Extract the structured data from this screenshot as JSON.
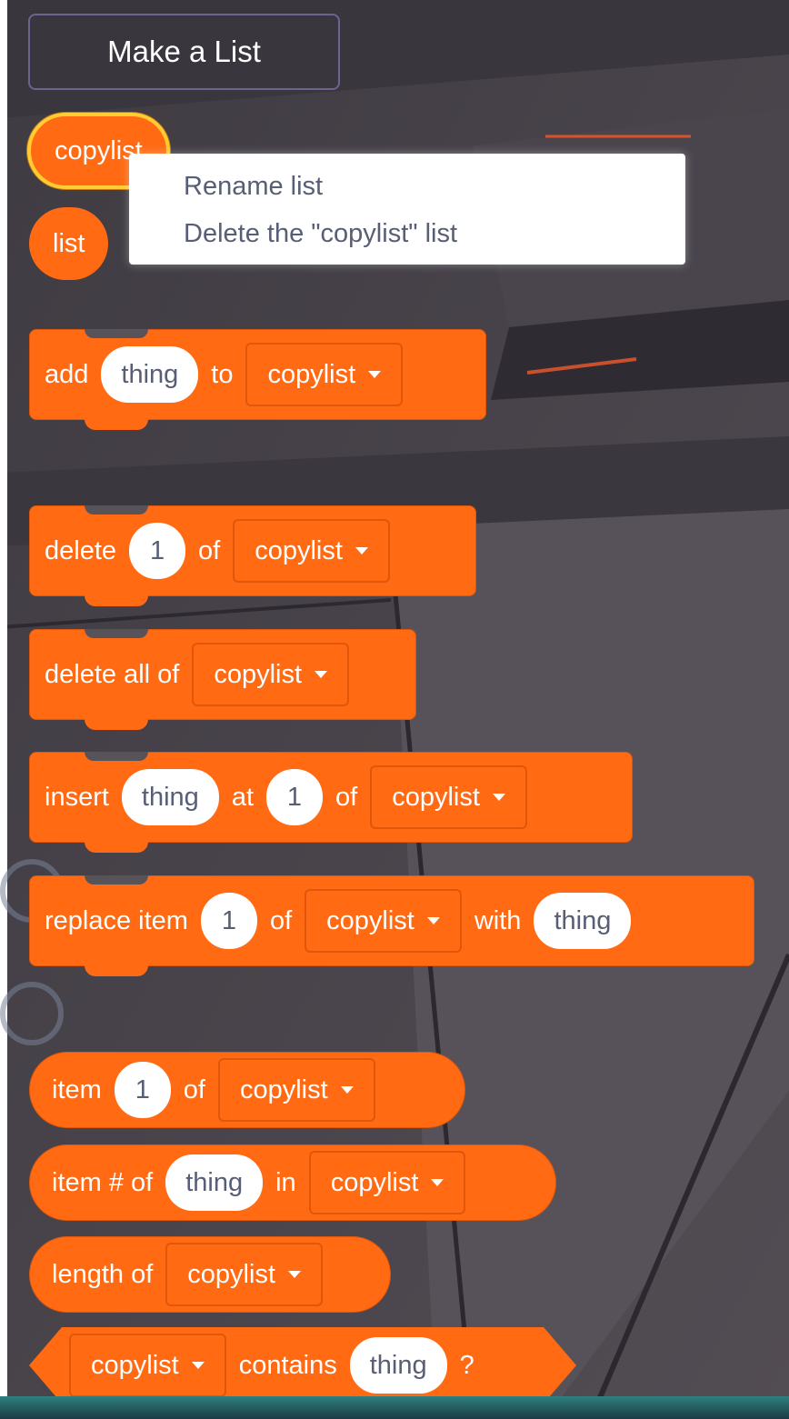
{
  "palette": {
    "make_list_button": "Make a List",
    "list_reporters": [
      {
        "label": "copylist",
        "selected": true
      },
      {
        "label": "list",
        "selected": false
      }
    ],
    "context_menu": [
      "Rename list",
      "Delete the \"copylist\" list"
    ],
    "blocks": {
      "add": {
        "t1": "add",
        "input": "thing",
        "t2": "to",
        "list": "copylist"
      },
      "delete": {
        "t1": "delete",
        "input": "1",
        "t2": "of",
        "list": "copylist"
      },
      "delete_all": {
        "t1": "delete all of",
        "list": "copylist"
      },
      "insert": {
        "t1": "insert",
        "input1": "thing",
        "t2": "at",
        "input2": "1",
        "t3": "of",
        "list": "copylist"
      },
      "replace": {
        "t1": "replace item",
        "input1": "1",
        "t2": "of",
        "list": "copylist",
        "t3": "with",
        "input2": "thing"
      },
      "item": {
        "t1": "item",
        "input": "1",
        "t2": "of",
        "list": "copylist"
      },
      "item_num": {
        "t1": "item # of",
        "input": "thing",
        "t2": "in",
        "list": "copylist"
      },
      "length": {
        "t1": "length of",
        "list": "copylist"
      },
      "contains": {
        "list": "copylist",
        "t1": "contains",
        "input": "thing",
        "t2": "?"
      }
    }
  },
  "colors": {
    "block_orange": "#ff6a13",
    "selected_outline": "#ffcc33",
    "background": "#4a454b"
  }
}
